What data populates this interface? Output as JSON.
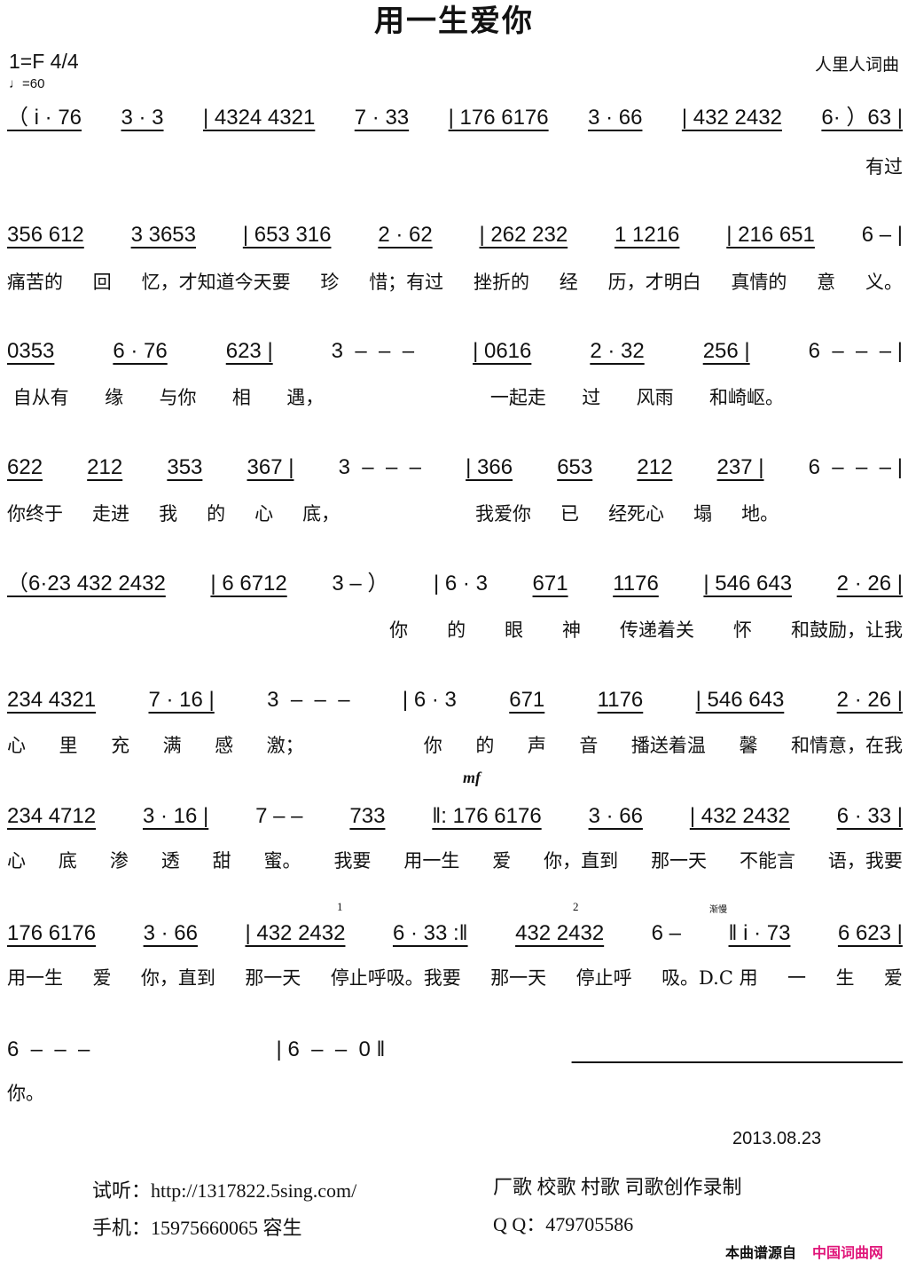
{
  "title": "用一生爱你",
  "key_signature": "1=F  4/4",
  "tempo": "♩=60",
  "composer": "人里人词曲",
  "rows": [
    {
      "notes": [
        "（ i · 76",
        "3 · 3",
        "| 4324 4321",
        "7 · 33",
        "| 176 6176",
        "3 · 66",
        "| 432 2432",
        "6· ）63 |"
      ],
      "lyrics": [
        "",
        "有过"
      ]
    },
    {
      "notes": [
        "356 612",
        "3 3653",
        "| 653 316",
        "2 · 62",
        "| 262 232",
        "1 1216",
        "| 216 651",
        "6 – |"
      ],
      "lyrics": [
        "痛苦的",
        "回",
        "忆，才知道今天要",
        "珍",
        "惜；有过",
        "挫折的",
        "经",
        "历，才明白",
        "真情的",
        "意",
        "义。"
      ]
    },
    {
      "notes": [
        "0353",
        "6 · 76",
        "623 |",
        "3  –  –  –",
        "| 0616",
        "2 · 32",
        "256 |",
        "6  –  –  – |"
      ],
      "lyrics": [
        " 自从有",
        "缘",
        "与你",
        "相",
        "遇，",
        "                ",
        "一起走",
        "过",
        "风雨",
        "和崎岖。",
        "              "
      ]
    },
    {
      "notes": [
        "622",
        "212",
        "353",
        "367 |",
        "3  –  –  –",
        "| 366",
        "653",
        "212",
        "237 |",
        "6  –  –  – |"
      ],
      "lyrics": [
        "你终于",
        "走进",
        "我",
        "的",
        "心",
        "底，",
        "             ",
        "我爱你",
        "已",
        "经死心",
        "塌",
        "地。",
        "                "
      ]
    },
    {
      "notes": [
        "（6·23 432 2432",
        "| 6 6712",
        "3 – ）",
        "| 6 · 3",
        "671",
        "1176",
        "| 546 643",
        "2 · 26 |"
      ],
      "lyrics": [
        "                                                          ",
        "你",
        "的",
        "眼",
        "神",
        "传递着关",
        "怀",
        "和鼓励，让我"
      ]
    },
    {
      "notes": [
        "234 4321",
        "7 · 16 |",
        "3  –  –  –",
        "| 6 · 3",
        "671",
        "1176",
        "| 546 643",
        "2 · 26 |"
      ],
      "lyrics": [
        "心",
        "里",
        "充",
        "满",
        "感",
        "激；",
        "         ",
        "你",
        "的",
        "声",
        "音",
        "播送着温",
        "馨",
        "和情意，在我"
      ]
    },
    {
      "notes": [
        "234 4712",
        "3 · 16 |",
        "7 – –",
        "733",
        "‖: 176 6176",
        "3 · 66",
        "| 432 2432",
        "6 · 33 |"
      ],
      "lyrics": [
        "心",
        "底",
        "渗",
        "透",
        "甜",
        "蜜。",
        "我要",
        "用一生",
        "爱",
        "你，直到",
        "那一天",
        "不能言",
        "语，我要"
      ]
    },
    {
      "notes": [
        "176 6176",
        "3 · 66",
        "| 432 2432",
        "6 · 33 :‖",
        "432 2432",
        "6 –",
        "‖ i · 73",
        "6 623 |"
      ],
      "lyrics": [
        "用一生",
        "爱",
        "你，直到",
        "那一天",
        "停止呼吸。我要",
        "那一天",
        "停止呼",
        "吸。D.C 用",
        "一",
        "生",
        "爱"
      ]
    },
    {
      "notes": [
        "6  –  –  –",
        "| 6  –  –  0 ‖",
        "                                                        "
      ],
      "lyrics": [
        "你。",
        ""
      ]
    }
  ],
  "marks": {
    "dynamic": "mf",
    "volta_1": "1",
    "volta_2": "2",
    "rit": "渐慢"
  },
  "date": "2013.08.23",
  "footer": {
    "listen": "试听：http://1317822.5sing.com/",
    "phone": "手机：15975660065 容生",
    "production": "厂歌 校歌 村歌 司歌创作录制",
    "qq": "Q Q：479705586",
    "source_label": "本曲谱源自",
    "source_site": "中国词曲网"
  }
}
